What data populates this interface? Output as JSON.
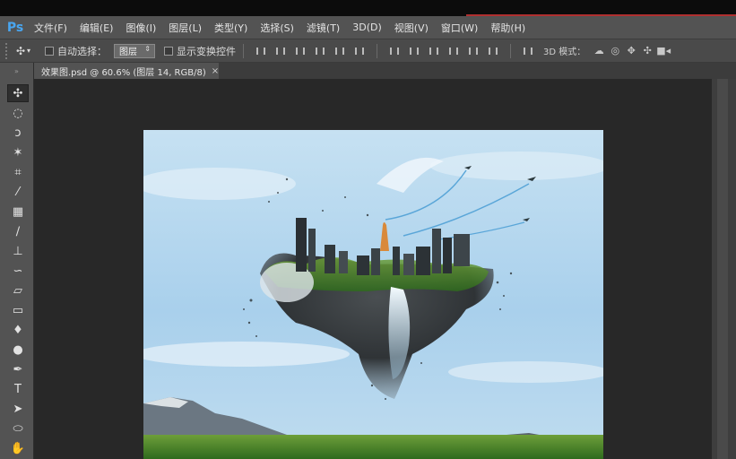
{
  "app": {
    "logo": "Ps"
  },
  "menu": [
    "文件(F)",
    "编辑(E)",
    "图像(I)",
    "图层(L)",
    "类型(Y)",
    "选择(S)",
    "滤镜(T)",
    "3D(D)",
    "视图(V)",
    "窗口(W)",
    "帮助(H)"
  ],
  "options": {
    "auto_select_label": "自动选择：",
    "auto_select_value": "图层",
    "show_transform_label": "显示变换控件",
    "mode_label": "3D 模式："
  },
  "document": {
    "tab_title": "效果图.psd @ 60.6% (图层 14, RGB/8)",
    "close_glyph": "×"
  },
  "colors": {
    "ps_blue": "#49a6f0",
    "panel": "#535353",
    "workspace": "#282828",
    "accent_red": "#b03030"
  },
  "icons": {
    "tools": [
      "move-tool-icon",
      "marquee-tool-icon",
      "lasso-tool-icon",
      "magic-wand-icon",
      "crop-tool-icon",
      "eyedropper-icon",
      "healing-brush-icon",
      "brush-tool-icon",
      "clone-stamp-icon",
      "history-brush-icon",
      "eraser-icon",
      "gradient-icon",
      "blur-tool-icon",
      "dodge-tool-icon",
      "pen-tool-icon",
      "type-tool-icon",
      "path-selection-icon",
      "ellipse-tool-icon",
      "hand-tool-icon"
    ]
  }
}
